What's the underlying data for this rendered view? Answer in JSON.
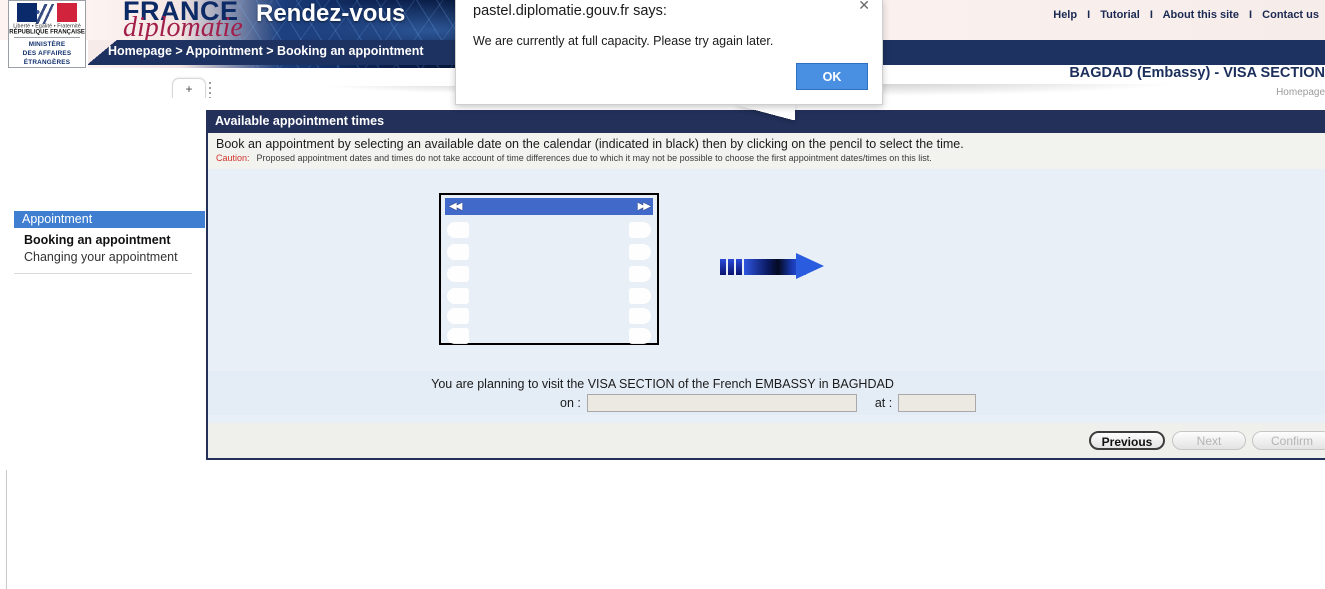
{
  "header": {
    "brand_line1": "FRANCE",
    "brand_line2": "diplomatie",
    "brand_service": "Rendez-vous",
    "logo": {
      "devise": "Liberté • Égalité • Fraternité",
      "republic": "RÉPUBLIQUE FRANÇAISE",
      "ministry_line1": "MINISTÈRE",
      "ministry_line2": "DES AFFAIRES",
      "ministry_line3": "ÉTRANGÈRES"
    },
    "top_links": [
      "Help",
      "Tutorial",
      "About this site",
      "Contact us"
    ],
    "link_separator": "I",
    "breadcrumb": "Homepage > Appointment > Booking an appointment",
    "post_title": "BAGDAD (Embassy) - VISA SECTION",
    "home_link": "Homepage",
    "tab_add_label": "+"
  },
  "sidebar": {
    "section_title": "Appointment",
    "items": [
      {
        "label": "Booking an appointment",
        "active": true
      },
      {
        "label": "Changing your appointment",
        "active": false
      }
    ]
  },
  "main": {
    "panel_title": "Available appointment times",
    "instruction": "Book an appointment by selecting an available date on the calendar (indicated in black) then by clicking on the pencil to select the time.",
    "caution_label": "Caution:",
    "caution_text": "Proposed appointment dates and times do not take account of time differences due to which it may not be possible to choose the first appointment dates/times on this list.",
    "calendar": {
      "prev_icon": "double-left-arrow",
      "next_icon": "double-right-arrow",
      "prev_glyph": "◀◀",
      "next_glyph": "▶▶",
      "rows": 6,
      "state": "empty"
    },
    "decoration_icon": "right-arrow-graphic"
  },
  "summary": {
    "sentence": "You are planning to visit the VISA SECTION of the French EMBASSY in BAGHDAD",
    "on_label": "on :",
    "on_value": "",
    "at_label": "at :",
    "at_value": ""
  },
  "buttons": {
    "previous": {
      "label": "Previous",
      "enabled": true
    },
    "next": {
      "label": "Next",
      "enabled": false
    },
    "confirm": {
      "label": "Confirm",
      "enabled": false
    }
  },
  "dialog": {
    "origin": "pastel.diplomatie.gouv.fr says:",
    "message": "We are currently at full capacity. Please try again later.",
    "ok_label": "OK",
    "close_glyph": "✕"
  },
  "colors": {
    "navy": "#22305a",
    "crumb_navy": "#1e3261",
    "sidebar_blue": "#3f7ed0",
    "panel_bg": "#e9eff7",
    "caution_red": "#d0342c",
    "dialog_button_blue": "#4a90e2"
  }
}
